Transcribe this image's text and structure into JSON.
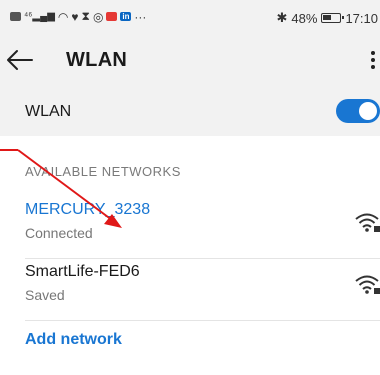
{
  "status_bar": {
    "left_icons": [
      "nfc-icon",
      "signal-icon",
      "wifi-icon",
      "heart-icon",
      "hourglass-icon",
      "whatsapp-icon",
      "red-app-icon",
      "linkedin-icon",
      "more-icon"
    ],
    "bluetooth_glyph": "✱",
    "battery_percent": "48%",
    "battery_level": 0.48,
    "time": "17:10"
  },
  "app_bar": {
    "title": "WLAN"
  },
  "wlan_toggle": {
    "label": "WLAN",
    "on": true,
    "accent": "#1976d2"
  },
  "networks_section": {
    "header": "AVAILABLE NETWORKS",
    "items": [
      {
        "name": "MERCURY_3238",
        "status": "Connected",
        "active": true
      },
      {
        "name": "SmartLife-FED6",
        "status": "Saved",
        "active": false
      }
    ]
  },
  "add_network": {
    "label": "Add network"
  },
  "annotation": {
    "color": "#e01818"
  }
}
